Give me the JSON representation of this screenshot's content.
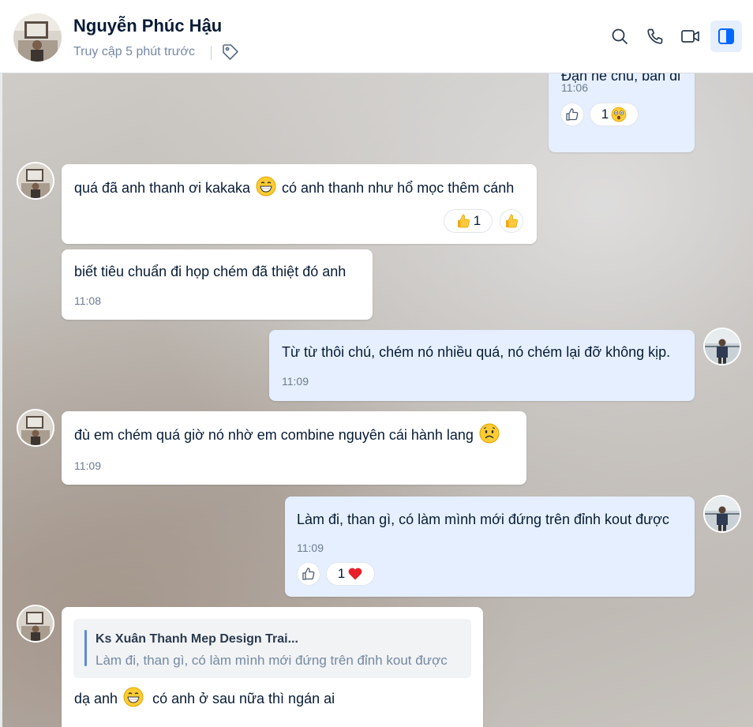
{
  "header": {
    "contact_name": "Nguyễn Phúc Hậu",
    "status": "Truy cập 5 phút trước",
    "icons": [
      "tag-icon",
      "search-icon",
      "phone-icon",
      "video-icon",
      "sidebar-toggle-icon"
    ]
  },
  "colors": {
    "accent": "#0068ff",
    "incoming_bubble": "#ffffff",
    "outgoing_bubble": "#e5efff",
    "time_text": "#6b7b8f"
  },
  "messages": [
    {
      "direction": "out",
      "text": "Đạn nè chú, bắn đi",
      "time": "11:06",
      "reactions": {
        "count": "1",
        "emoji": "astonished-emoji"
      }
    },
    {
      "direction": "in",
      "text_before": "quá đã anh thanh ơi kakaka",
      "emoji": "grinning-emoji",
      "text_after": "có anh thanh như hổ mọc thêm cánh",
      "reactions": {
        "count": "1",
        "emoji": "thumbs-up-emoji"
      }
    },
    {
      "direction": "in",
      "text": "biết tiêu chuẩn đi họp chém đã thiệt đó anh",
      "time": "11:08"
    },
    {
      "direction": "out",
      "text": "Từ từ thôi chú, chém nó nhiều quá, nó chém lại đỡ không kịp.",
      "time": "11:09"
    },
    {
      "direction": "in",
      "text": "đù em chém quá giờ nó nhờ em combine nguyên cái hành lang",
      "emoji": "frowning-emoji",
      "time": "11:09"
    },
    {
      "direction": "out",
      "text": "Làm đi, than gì, có làm mình mới đứng trên đỉnh kout được",
      "time": "11:09",
      "reactions": {
        "count": "1",
        "emoji": "heart-emoji"
      }
    },
    {
      "direction": "in",
      "quote": {
        "author": "Ks Xuân Thanh Mep Design Trai...",
        "text": "Làm đi, than gì, có làm mình mới đứng trên đỉnh kout được"
      },
      "text_before": "dạ anh",
      "emoji": "grinning-emoji",
      "text_after": "có anh ở sau nữa thì ngán ai"
    }
  ]
}
